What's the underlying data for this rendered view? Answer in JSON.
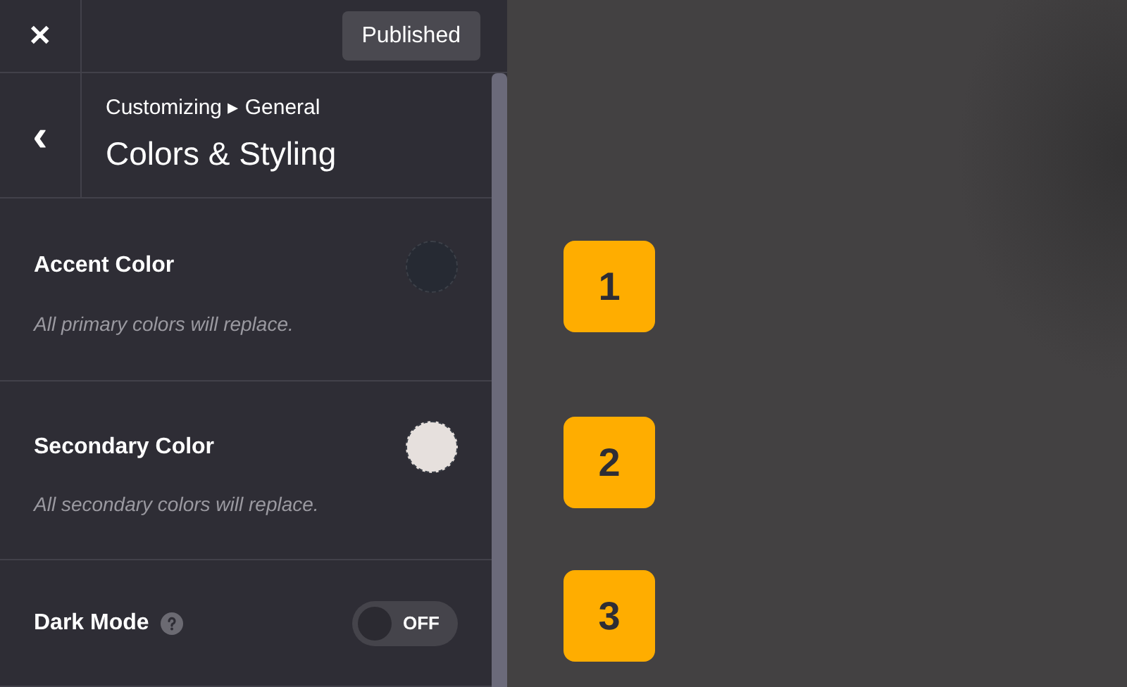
{
  "top_bar": {
    "close": "✕",
    "publish_button": "Published"
  },
  "header": {
    "back": "‹",
    "breadcrumb": "Customizing ▸ General",
    "title": "Colors & Styling"
  },
  "settings": [
    {
      "kind": "color",
      "label": "Accent Color",
      "description": "All primary colors will replace.",
      "color": "#262a33"
    },
    {
      "kind": "color",
      "label": "Secondary Color",
      "description": "All secondary colors will replace.",
      "color": "#e6e0dd"
    },
    {
      "kind": "toggle",
      "label": "Dark Mode",
      "on": false,
      "toggle_text": "OFF"
    }
  ],
  "markers": [
    "1",
    "2",
    "3"
  ]
}
